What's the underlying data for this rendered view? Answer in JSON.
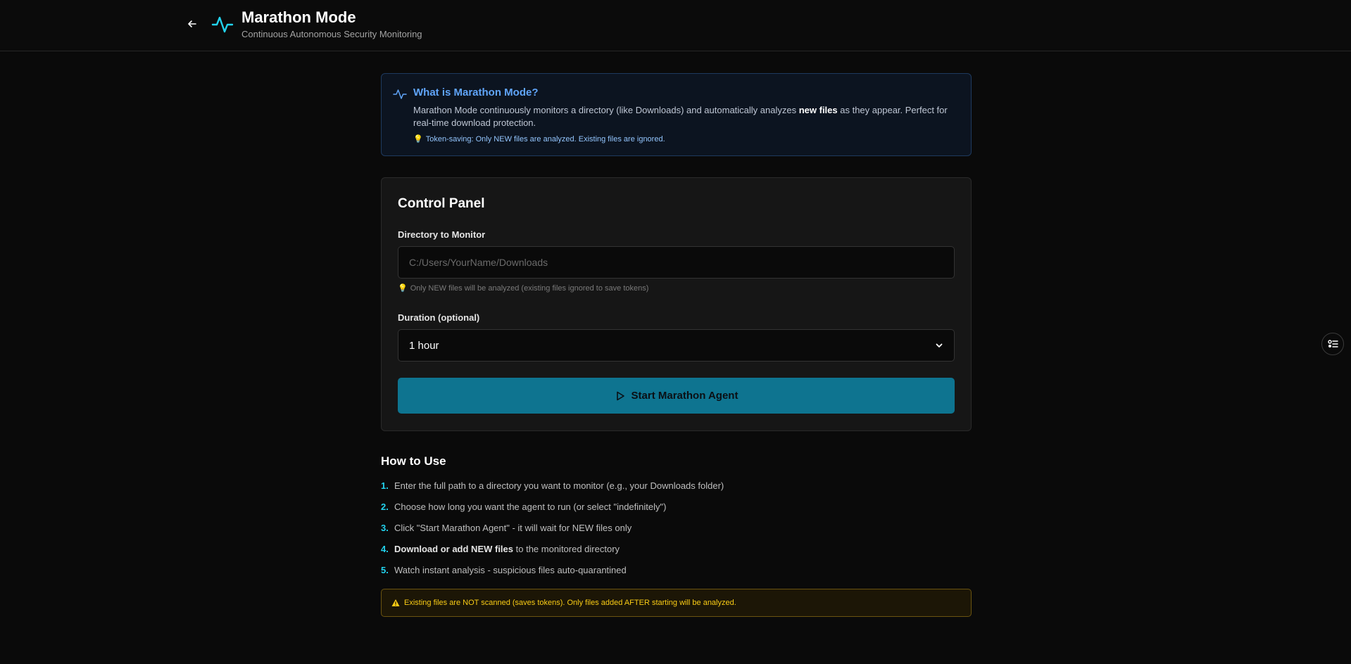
{
  "header": {
    "title": "Marathon Mode",
    "subtitle": "Continuous Autonomous Security Monitoring"
  },
  "info": {
    "title": "What is Marathon Mode?",
    "desc_before": "Marathon Mode continuously monitors a directory (like Downloads) and automatically analyzes ",
    "desc_bold": "new files",
    "desc_after": " as they appear. Perfect for real-time download protection.",
    "tip": "Token-saving: Only NEW files are analyzed. Existing files are ignored."
  },
  "control_panel": {
    "title": "Control Panel",
    "directory_label": "Directory to Monitor",
    "directory_placeholder": "C:/Users/YourName/Downloads",
    "directory_hint": "Only NEW files will be analyzed (existing files ignored to save tokens)",
    "duration_label": "Duration (optional)",
    "duration_value": "1 hour",
    "start_label": "Start Marathon Agent"
  },
  "how_to": {
    "title": "How to Use",
    "steps": [
      {
        "num": "1.",
        "bold": "",
        "text": "Enter the full path to a directory you want to monitor (e.g., your Downloads folder)"
      },
      {
        "num": "2.",
        "bold": "",
        "text": "Choose how long you want the agent to run (or select \"indefinitely\")"
      },
      {
        "num": "3.",
        "bold": "",
        "text": "Click \"Start Marathon Agent\" - it will wait for NEW files only"
      },
      {
        "num": "4.",
        "bold": "Download or add NEW files",
        "text": " to the monitored directory"
      },
      {
        "num": "5.",
        "bold": "",
        "text": "Watch instant analysis - suspicious files auto-quarantined"
      }
    ]
  },
  "warning": "Existing files are NOT scanned (saves tokens). Only files added AFTER starting will be analyzed.",
  "colors": {
    "accent": "#22d3ee",
    "button": "#0e7490",
    "info_title": "#60a5fa",
    "warning": "#facc15"
  }
}
